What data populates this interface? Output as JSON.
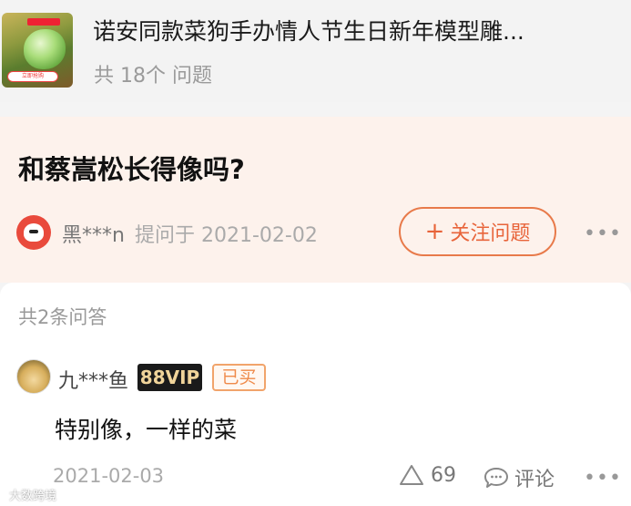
{
  "product": {
    "title": "诺安同款菜狗手办情人节生日新年模型雕...",
    "question_count": "共 18个 问题",
    "thumb_pill": "立即抢购"
  },
  "question": {
    "text": "和蔡嵩松长得像吗?",
    "asker_name": "黑***n",
    "asked_meta": "提问于 2021-02-02",
    "follow_label": "关注问题",
    "follow_plus": "+",
    "more": "•••"
  },
  "answers": {
    "count_label": "共2条问答",
    "items": [
      {
        "name": "九***鱼",
        "vip": "88VIP",
        "bought": "已买",
        "text": "特别像，一样的菜",
        "date": "2021-02-03",
        "likes": "69",
        "comment_label": "评论",
        "more": "•••"
      }
    ]
  },
  "watermark": "大数跨境",
  "icons": {
    "like": "thumbs-up-triangle-icon",
    "comment": "speech-bubble-icon",
    "more": "ellipsis-icon"
  },
  "colors": {
    "accent": "#e8643a",
    "question_bg": "#fdf2ec",
    "vip_bg": "#1a1a1a",
    "vip_text": "#f0d49a"
  }
}
